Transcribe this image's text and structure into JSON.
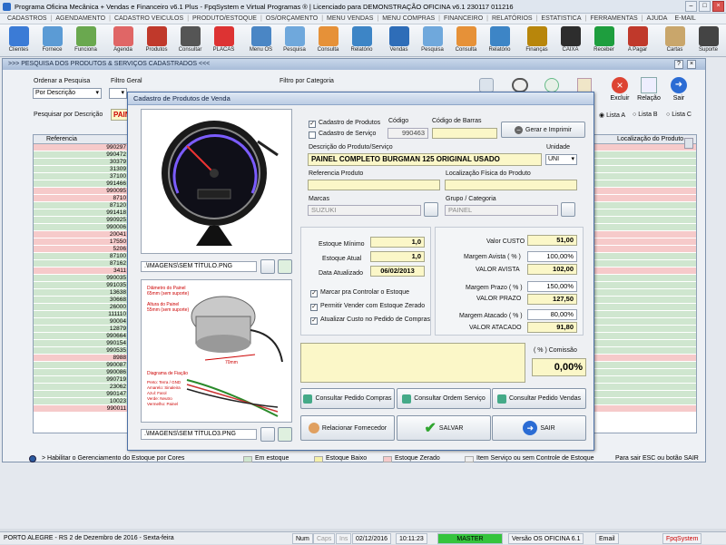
{
  "window": {
    "title": "Programa Oficina Mecânica + Vendas e Financeiro v6.1 Plus - FpqSystem e Virtual Programas ® | Licenciado para  DEMONSTRAÇÃO OFICINA v6.1 230117 011216"
  },
  "menu": [
    "CADASTROS",
    "AGENDAMENTO",
    "CADASTRO VEICULOS",
    "PRODUTO/ESTOQUE",
    "OS/ORÇAMENTO",
    "MENU VENDAS",
    "MENU COMPRAS",
    "FINANCEIRO",
    "RELATÓRIOS",
    "ESTATISTICA",
    "FERRAMENTAS",
    "AJUDA",
    "E-MAIL"
  ],
  "toolbar": [
    {
      "label": "Clientes",
      "color": "#3b7bd6"
    },
    {
      "label": "Fornece",
      "color": "#5b9bd5"
    },
    {
      "label": "Funciona",
      "color": "#6aa84f"
    },
    {
      "label": "Agenda",
      "color": "#e06666"
    },
    {
      "label": "Produtos",
      "color": "#c0392b"
    },
    {
      "label": "Consultar",
      "color": "#555"
    },
    {
      "label": "PLACAS",
      "color": "#d33"
    },
    {
      "label": "Menu OS",
      "color": "#4a86c5"
    },
    {
      "label": "Pesquisa",
      "color": "#6fa8dc"
    },
    {
      "label": "Consulta",
      "color": "#e69138"
    },
    {
      "label": "Relatório",
      "color": "#3d85c6"
    },
    {
      "label": "Vendas",
      "color": "#2e6db8"
    },
    {
      "label": "Pesquisa",
      "color": "#6fa8dc"
    },
    {
      "label": "Consulta",
      "color": "#e69138"
    },
    {
      "label": "Relatório",
      "color": "#3d85c6"
    },
    {
      "label": "Finanças",
      "color": "#b8860b"
    },
    {
      "label": "CAIXA",
      "color": "#2d2d2d"
    },
    {
      "label": "Receber",
      "color": "#1e9e3e"
    },
    {
      "label": "A Pagar",
      "color": "#c0392b"
    },
    {
      "label": "Cartas",
      "color": "#c9a66b"
    },
    {
      "label": "Suporte",
      "color": "#444"
    },
    {
      "label": "",
      "color": "#2a8f3a"
    }
  ],
  "inner": {
    "title": ">>> PESQUISA DOS PRODUTOS & SERVIÇOS CADASTRADOS <<<",
    "order_label": "Ordenar a Pesquisa",
    "order_value": "Por Descrição",
    "filter_label": "Filtro Geral",
    "category_label": "Filtro por Categoria",
    "search_label": "Pesquisar por Descrição",
    "search_value": "PAIN",
    "col_ref": "Referencia",
    "col_loc": "Localização do Produto",
    "list_a": "Lista A",
    "list_b": "Lista B",
    "list_c": "Lista C",
    "excluir": "Excluir",
    "relacao": "Relação",
    "sair": "Sair",
    "refs": [
      "990297",
      "990472",
      "30379",
      "31309",
      "37100",
      "991466",
      "990095",
      "8710",
      "87120",
      "991418",
      "990925",
      "990006",
      "20041",
      "17550",
      "5206",
      "87100",
      "87162",
      "3411",
      "990035",
      "991035",
      "13638",
      "30668",
      "26000",
      "111110",
      "90004",
      "12879",
      "990664",
      "990154",
      "990535",
      "8988",
      "990087",
      "990086",
      "990719",
      "23062",
      "990147",
      "10023",
      "990011"
    ],
    "rowtypes": [
      "r",
      "g",
      "g",
      "g",
      "g",
      "g",
      "r",
      "r",
      "g",
      "g",
      "g",
      "g",
      "r",
      "r",
      "r",
      "g",
      "g",
      "r",
      "g",
      "g",
      "g",
      "g",
      "g",
      "g",
      "g",
      "g",
      "g",
      "g",
      "g",
      "r",
      "g",
      "g",
      "g",
      "g",
      "g",
      "g",
      "r"
    ]
  },
  "legend": {
    "toggle": "> Habilitar o Gerenciamento do Estoque por Cores",
    "items": [
      {
        "label": "Em estoque",
        "color": "#cfe6cf"
      },
      {
        "label": "Estoque Baixo",
        "color": "#f5f0a8"
      },
      {
        "label": "Estoque Zerado",
        "color": "#f6caca"
      },
      {
        "label": "Item Serviço ou sem Controle de Estoque",
        "color": "#eeeeee"
      }
    ],
    "exit_hint": "Para sair ESC ou botão SAIR"
  },
  "status": {
    "city": "PORTO ALEGRE - RS   2 de Dezembro de 2016 - Sexta-feira",
    "num": "Num",
    "caps": "Caps",
    "ins": "Ins",
    "date": "02/12/2016",
    "time": "10:11:23",
    "master": "MASTER",
    "version": "Versão OS OFICINA 6.1",
    "email": "Email",
    "brand": "FpqSystem"
  },
  "dialog": {
    "title": "Cadastro de Produtos de Venda",
    "chk_produtos": "Cadastro de Produtos",
    "chk_servico": "Cadastro de Serviço",
    "codigo_label": "Código",
    "codigo": "990463",
    "barras_label": "Código de Barras",
    "barras": "",
    "gerar": "Gerar e Imprimir",
    "desc_label": "Descrição do Produto/Serviço",
    "desc": "PAINEL COMPLETO BURGMAN 125 ORIGINAL USADO",
    "unidade_label": "Unidade",
    "unidade": "UNI",
    "ref_label": "Referencia Produto",
    "ref": "",
    "loc_label": "Localização Física do Produto",
    "loc": "",
    "marcas_label": "Marcas",
    "marca": "SUZUKI",
    "grupo_label": "Grupo / Categoria",
    "grupo": "PAINEL",
    "img1_path": ".\\IMAGENS\\SEM TÍTULO.PNG",
    "img2_path": ".\\IMAGENS\\SEM TÍTULO3.PNG",
    "estmin_label": "Estoque Mínimo",
    "estmin": "1,0",
    "estatual_label": "Estoque Atual",
    "estatual": "1,0",
    "dataatu_label": "Data Atualizado",
    "dataatu": "06/02/2013",
    "chk_controlar": "Marcar pra Controlar o Estoque",
    "chk_vender": "Permitir Vender com Estoque Zerado",
    "chk_atualizar": "Atualizar Custo no Pedido de Compras",
    "custo_label": "Valor CUSTO",
    "custo": "51,00",
    "margav_label": "Margem Avista ( % )",
    "margav": "100,00%",
    "valav_label": "VALOR AVISTA",
    "valav": "102,00",
    "margpr_label": "Margem Prazo ( % )",
    "margpr": "150,00%",
    "valpr_label": "VALOR PRAZO",
    "valpr": "127,50",
    "margat_label": "Margem Atacado ( % )",
    "margat": "80,00%",
    "valat_label": "VALOR ATACADO",
    "valat": "91,80",
    "comissao_label": "( % ) Comissão",
    "comissao": "0,00%",
    "btn_pedcompras": "Consultar Pedido Compras",
    "btn_ordserv": "Consultar Ordem Serviço",
    "btn_pedvendas": "Consultar Pedido Vendas",
    "btn_fornecedor": "Relacionar Fornecedor",
    "btn_salvar": "SALVAR",
    "btn_sair": "SAIR",
    "diag_text": {
      "d1": "Diâmetro do Painel",
      "d2": "65mm (sem suporte)",
      "a1": "Altura do Painel",
      "a2": "55mm (sem suporte)",
      "size": "70mm",
      "fl": "Diagrama de Fiação",
      "w1": "Preto: Terra / GND",
      "w2": "Amarelo: Sinaleira",
      "w3": "Azul: Farol",
      "w4": "Verde: Neutro",
      "w5": "Vermelho: Painel"
    }
  }
}
